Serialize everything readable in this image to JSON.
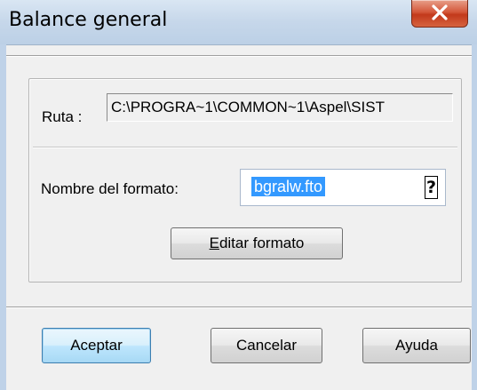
{
  "window": {
    "title": "Balance general"
  },
  "ruta": {
    "label": "Ruta :",
    "value": "C:\\PROGRA~1\\COMMON~1\\Aspel\\SIST"
  },
  "formato": {
    "label": "Nombre del formato:",
    "value": "bgralw.fto",
    "help_glyph": "?"
  },
  "buttons": {
    "editar_mnemonic": "E",
    "editar_rest": "ditar formato",
    "aceptar": "Aceptar",
    "cancelar": "Cancelar",
    "ayuda": "Ayuda"
  },
  "icons": {
    "close": "close-icon"
  },
  "colors": {
    "selection": "#3399ff",
    "default_button_border": "#3c7fb1",
    "close_button": "#c2391b"
  }
}
